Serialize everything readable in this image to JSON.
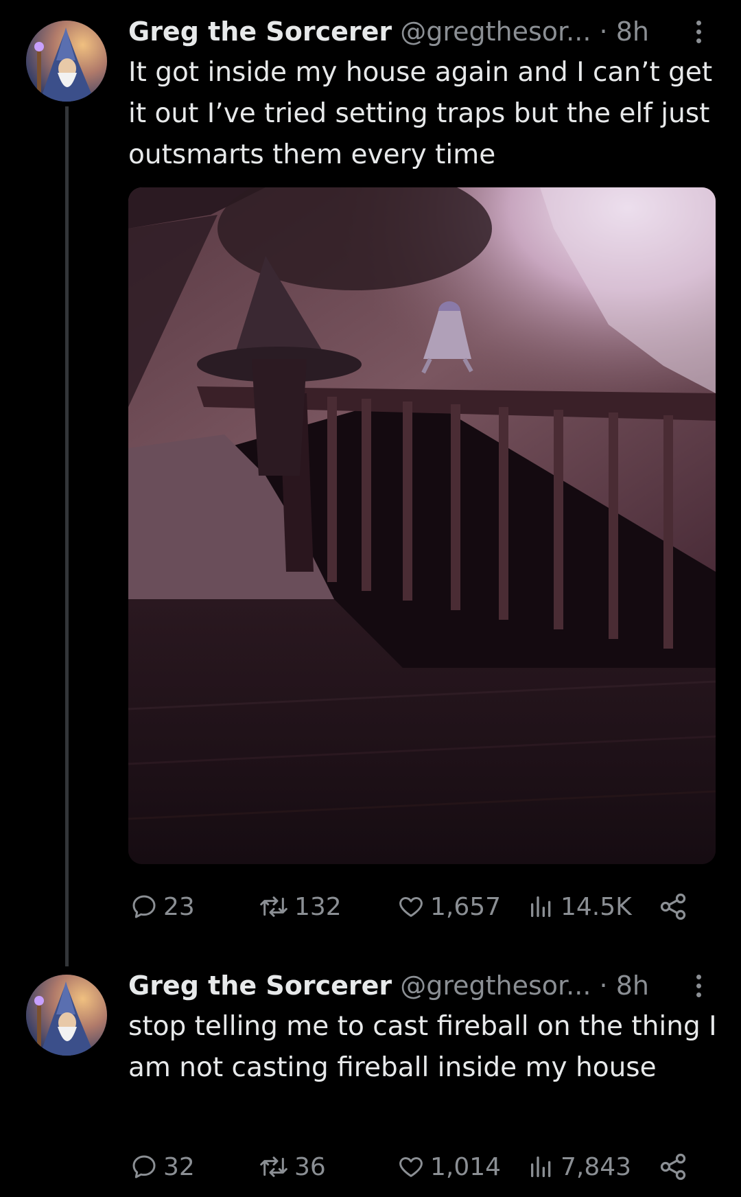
{
  "tweets": [
    {
      "author_name": "Greg the Sorcerer",
      "handle": "@gregthesor...",
      "separator": "·",
      "time": "8h",
      "text": "It got inside my house again and I can’t get it out  I’ve tried setting traps but the elf just outsmarts them every time",
      "media": "photo-staircase-elf",
      "replies": "23",
      "reposts": "132",
      "likes": "1,657",
      "views": "14.5K"
    },
    {
      "author_name": "Greg the Sorcerer",
      "handle": "@gregthesor...",
      "separator": "·",
      "time": "8h",
      "text": "stop telling me to cast fireball on the thing I am not casting fireball inside my house",
      "replies": "32",
      "reposts": "36",
      "likes": "1,014",
      "views": "7,843"
    }
  ],
  "icons": {
    "reply": "speech-bubble-icon",
    "repost": "repost-arrows-icon",
    "like": "heart-icon",
    "views": "bar-chart-icon",
    "share": "share-nodes-icon",
    "more": "more-vertical-icon"
  },
  "colors": {
    "background": "#000000",
    "text_primary": "#e7e9ea",
    "text_secondary": "#8b8f94",
    "thread_line": "#333639"
  }
}
